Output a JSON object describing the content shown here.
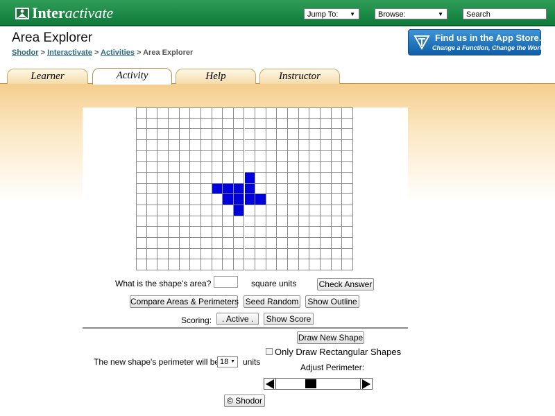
{
  "header": {
    "logo_prefix": "Inter",
    "logo_suffix": "activate",
    "jump_label": "Jump To:",
    "browse_label": "Browse:",
    "search_label": "Search"
  },
  "page": {
    "title": "Area Explorer",
    "breadcrumb": [
      "Shodor",
      "Interactivate",
      "Activities",
      "Area Explorer"
    ],
    "breadcrumb_sep": ">",
    "appstore_line1": "Find us in the App Store.",
    "appstore_line2": "Change a Function, Change the World"
  },
  "tabs": [
    {
      "label": "Learner",
      "active": false
    },
    {
      "label": "Activity",
      "active": true
    },
    {
      "label": "Help",
      "active": false
    },
    {
      "label": "Instructor",
      "active": false
    }
  ],
  "grid": {
    "cols": 20,
    "rows": 15,
    "fill_color": "#0000dd",
    "filled": [
      [
        6,
        10
      ],
      [
        7,
        7
      ],
      [
        7,
        8
      ],
      [
        7,
        9
      ],
      [
        7,
        10
      ],
      [
        8,
        8
      ],
      [
        8,
        9
      ],
      [
        8,
        10
      ],
      [
        8,
        11
      ],
      [
        9,
        9
      ]
    ]
  },
  "controls": {
    "area_question": "What is the shape's area?",
    "area_value": "",
    "units_label": "square units",
    "check_answer": "Check Answer",
    "compare": "Compare Areas & Perimeters",
    "seed_random": "Seed Random",
    "show_outline": "Show Outline",
    "scoring_label": "Scoring:",
    "active_button": ". Active .",
    "show_score": "Show Score",
    "draw_new_shape": "Draw New Shape",
    "only_rect": "Only Draw Rectangular Shapes",
    "only_rect_checked": false,
    "perimeter_label": "The new shape's perimeter will be:",
    "perimeter_value": "18",
    "perimeter_units": "units",
    "adjust_label": "Adjust Perimeter:",
    "slider_position": 0.4,
    "copyright": "© Shodor"
  }
}
